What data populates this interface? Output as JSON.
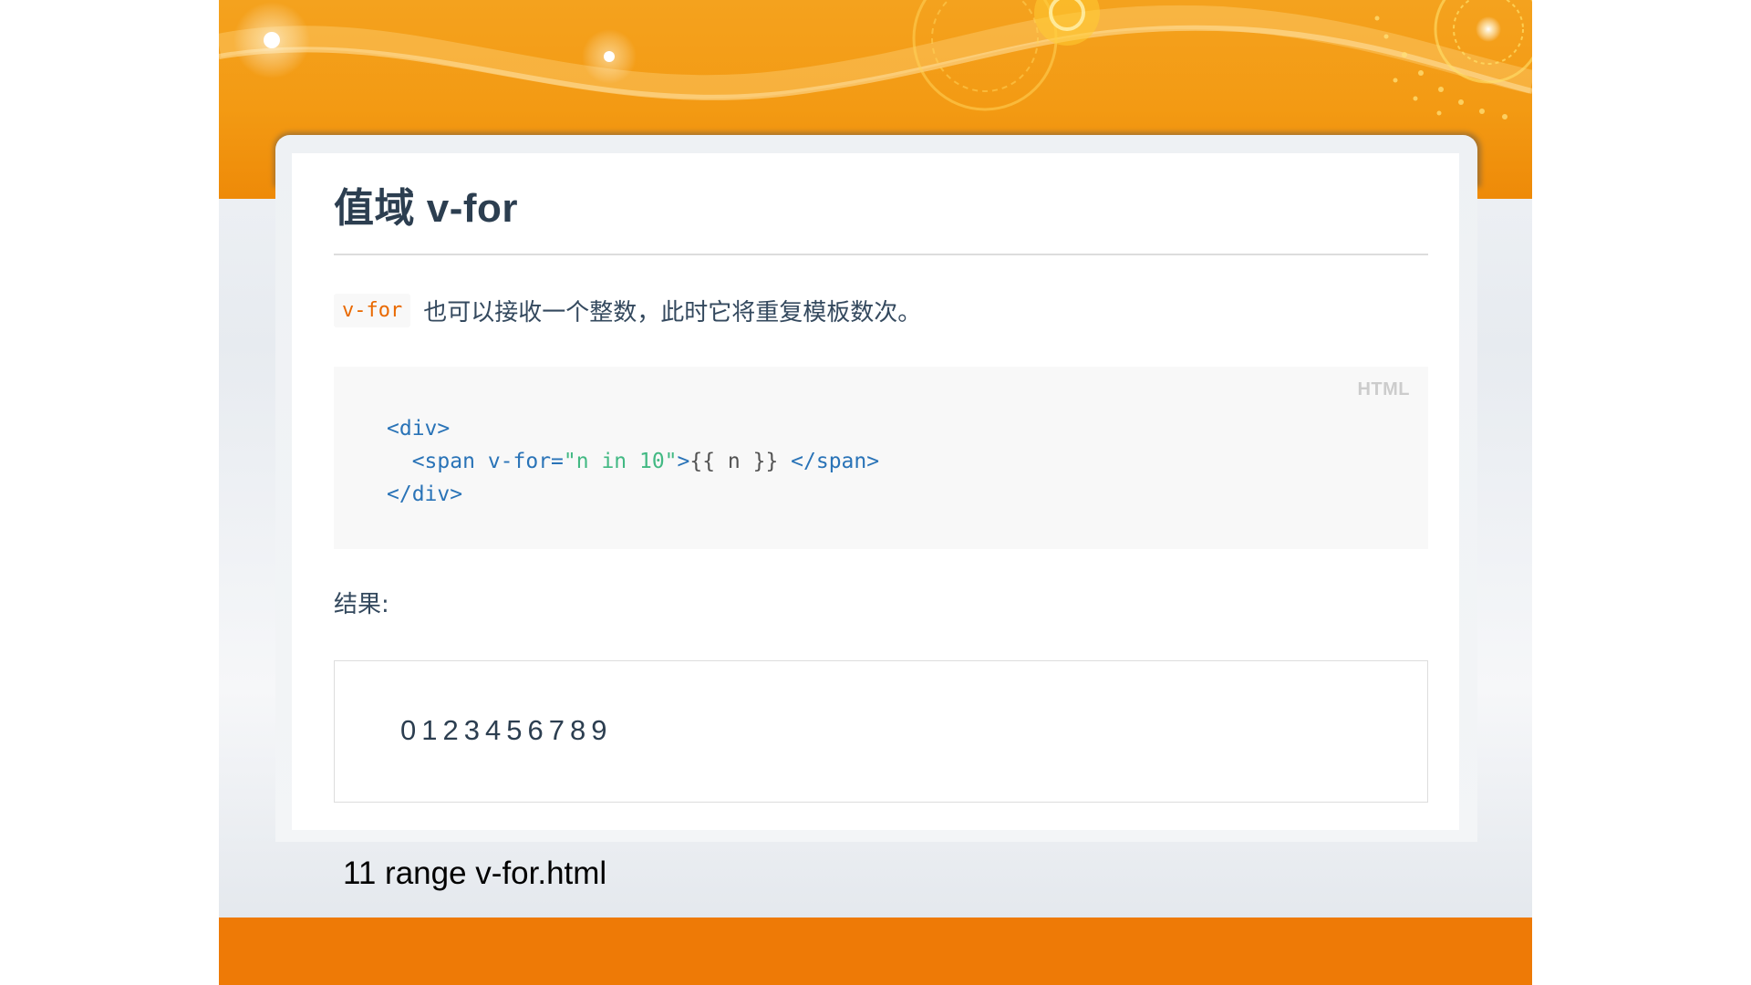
{
  "slide": {
    "title": "值域 v-for",
    "intro": {
      "code": "v-for",
      "text": "也可以接收一个整数，此时它将重复模板数次。"
    },
    "code_block": {
      "language": "HTML",
      "lines": [
        [
          {
            "t": "tag",
            "v": "<div>"
          }
        ],
        [
          {
            "t": "plain",
            "v": "  "
          },
          {
            "t": "tag",
            "v": "<span"
          },
          {
            "t": "plain",
            "v": " "
          },
          {
            "t": "attr",
            "v": "v-for="
          },
          {
            "t": "str",
            "v": "\"n in 10\""
          },
          {
            "t": "tag",
            "v": ">"
          },
          {
            "t": "plain",
            "v": "{{ n }} "
          },
          {
            "t": "tag",
            "v": "</span>"
          }
        ],
        [
          {
            "t": "tag",
            "v": "</div>"
          }
        ]
      ]
    },
    "result_label": "结果:",
    "result_numbers": [
      "0",
      "1",
      "2",
      "3",
      "4",
      "5",
      "6",
      "7",
      "8",
      "9"
    ],
    "caption": "11 range v-for.html"
  },
  "colors": {
    "banner_orange": "#f39a13",
    "footer_orange": "#ee7a06",
    "code_accent": "#e96900",
    "tag_blue": "#2973b7",
    "string_green": "#42b983",
    "text_dark": "#2c3e50"
  }
}
